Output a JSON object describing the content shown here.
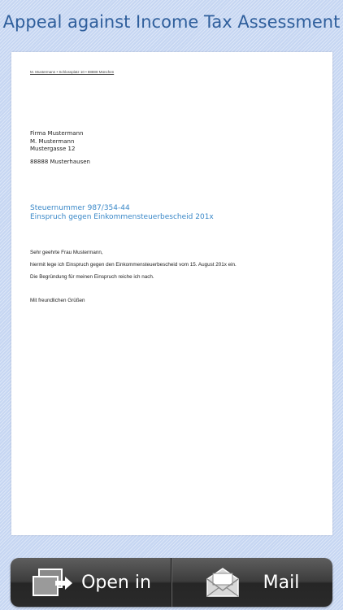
{
  "header": {
    "title": "Appeal against Income Tax Assessment"
  },
  "letter": {
    "return_address": "M. Mustermann • Schlossplatz 10 • 88888 München",
    "recipient": {
      "line1": "Firma Mustermann",
      "line2": "M. Mustermann",
      "line3": "Mustergasse 12",
      "line4": "88888 Musterhausen"
    },
    "subject": {
      "line1": "Steuernummer 987/354-44",
      "line2": "Einspruch gegen Einkommensteuerbescheid 201x"
    },
    "salutation": "Sehr geehrte Frau Mustermann,",
    "body1": "hiermit lege ich Einspruch gegen den Einkommensteuerbescheid vom 15. August 201x ein.",
    "body2": "Die Begründung für meinen Einspruch reiche ich nach.",
    "closing": "Mit freundlichen Grüßen"
  },
  "toolbar": {
    "open_in_label": "Open in",
    "open_in_icon": "open-in-icon",
    "mail_label": "Mail",
    "mail_icon": "mail-envelope-icon"
  },
  "colors": {
    "title": "#2f5f9c",
    "subject": "#3a88c8",
    "background": "#c9d8f3"
  }
}
